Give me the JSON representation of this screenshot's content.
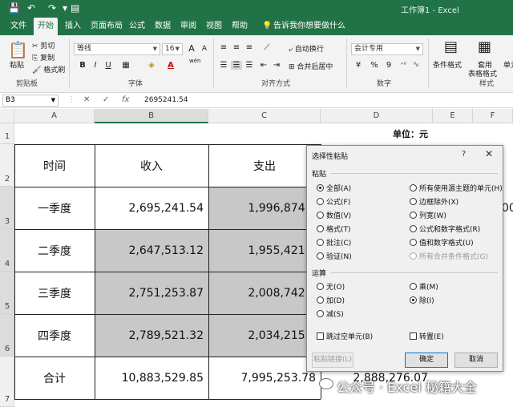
{
  "titlebar": {
    "title": "工作簿1 - Excel",
    "save_icon": "💾",
    "undo_icon": "↶",
    "redo_icon": "↷",
    "more_icon": "▾",
    "doc_icon": "▤"
  },
  "tabs": [
    "文件",
    "开始",
    "插入",
    "页面布局",
    "公式",
    "数据",
    "审阅",
    "视图",
    "帮助"
  ],
  "tell_me": "告诉我你想要做什么",
  "ribbon": {
    "clipboard": {
      "paste": "粘贴",
      "cut": "剪切",
      "copy": "复制",
      "format_painter": "格式刷",
      "group": "剪贴板"
    },
    "font": {
      "name": "等线",
      "size": "16",
      "bold": "B",
      "italic": "I",
      "underline": "U",
      "group": "字体",
      "grow": "A",
      "shrink": "A",
      "wen": "wén"
    },
    "align": {
      "wrap": "自动换行",
      "merge": "合并后居中",
      "group": "对齐方式"
    },
    "number": {
      "format": "会计专用",
      "percent": "%",
      "comma": "9",
      "group": "数字"
    },
    "styles": {
      "cond": "条件格式",
      "table": "套用",
      "table2": "表格格式",
      "cell": "单元",
      "group": "样式"
    }
  },
  "formula_bar": {
    "name_box": "B3",
    "cancel": "✕",
    "enter": "✓",
    "fx": "fx",
    "value": "2695241.54"
  },
  "columns": [
    "A",
    "B",
    "C",
    "D",
    "E",
    "F"
  ],
  "rows": [
    "1",
    "2",
    "3",
    "4",
    "5",
    "6",
    "7"
  ],
  "sheet": {
    "unit": "单位：元",
    "headers": [
      "时间",
      "收入",
      "支出"
    ],
    "data": [
      {
        "time": "一季度",
        "income": "2,695,241.54",
        "expense": "1,996,874.2"
      },
      {
        "time": "二季度",
        "income": "2,647,513.12",
        "expense": "1,955,421.3"
      },
      {
        "time": "三季度",
        "income": "2,751,253.87",
        "expense": "2,008,742.5"
      },
      {
        "time": "四季度",
        "income": "2,789,521.32",
        "expense": "2,034,215.6"
      }
    ],
    "total": {
      "label": "合计",
      "income": "10,883,529.85",
      "expense": "7,995,253.78",
      "d": "2,888,276.07"
    },
    "f3_partial": "00"
  },
  "dialog": {
    "title": "选择性粘贴",
    "help": "?",
    "close": "✕",
    "paste_section": "粘贴",
    "paste_left": [
      "全部(A)",
      "公式(F)",
      "数值(V)",
      "格式(T)",
      "批注(C)",
      "验证(N)"
    ],
    "paste_right": [
      "所有使用源主题的单元(H)",
      "边框除外(X)",
      "列宽(W)",
      "公式和数字格式(R)",
      "值和数字格式(U)",
      "所有合并条件格式(G)"
    ],
    "op_section": "运算",
    "op_left": [
      "无(O)",
      "加(D)",
      "减(S)"
    ],
    "op_right": [
      "乘(M)",
      "除(I)"
    ],
    "skip_blanks": "跳过空单元(B)",
    "transpose": "转置(E)",
    "paste_link": "粘贴链接(L)",
    "ok": "确定",
    "cancel": "取消"
  },
  "watermark": "公众号 · Excel 秘籍大全"
}
